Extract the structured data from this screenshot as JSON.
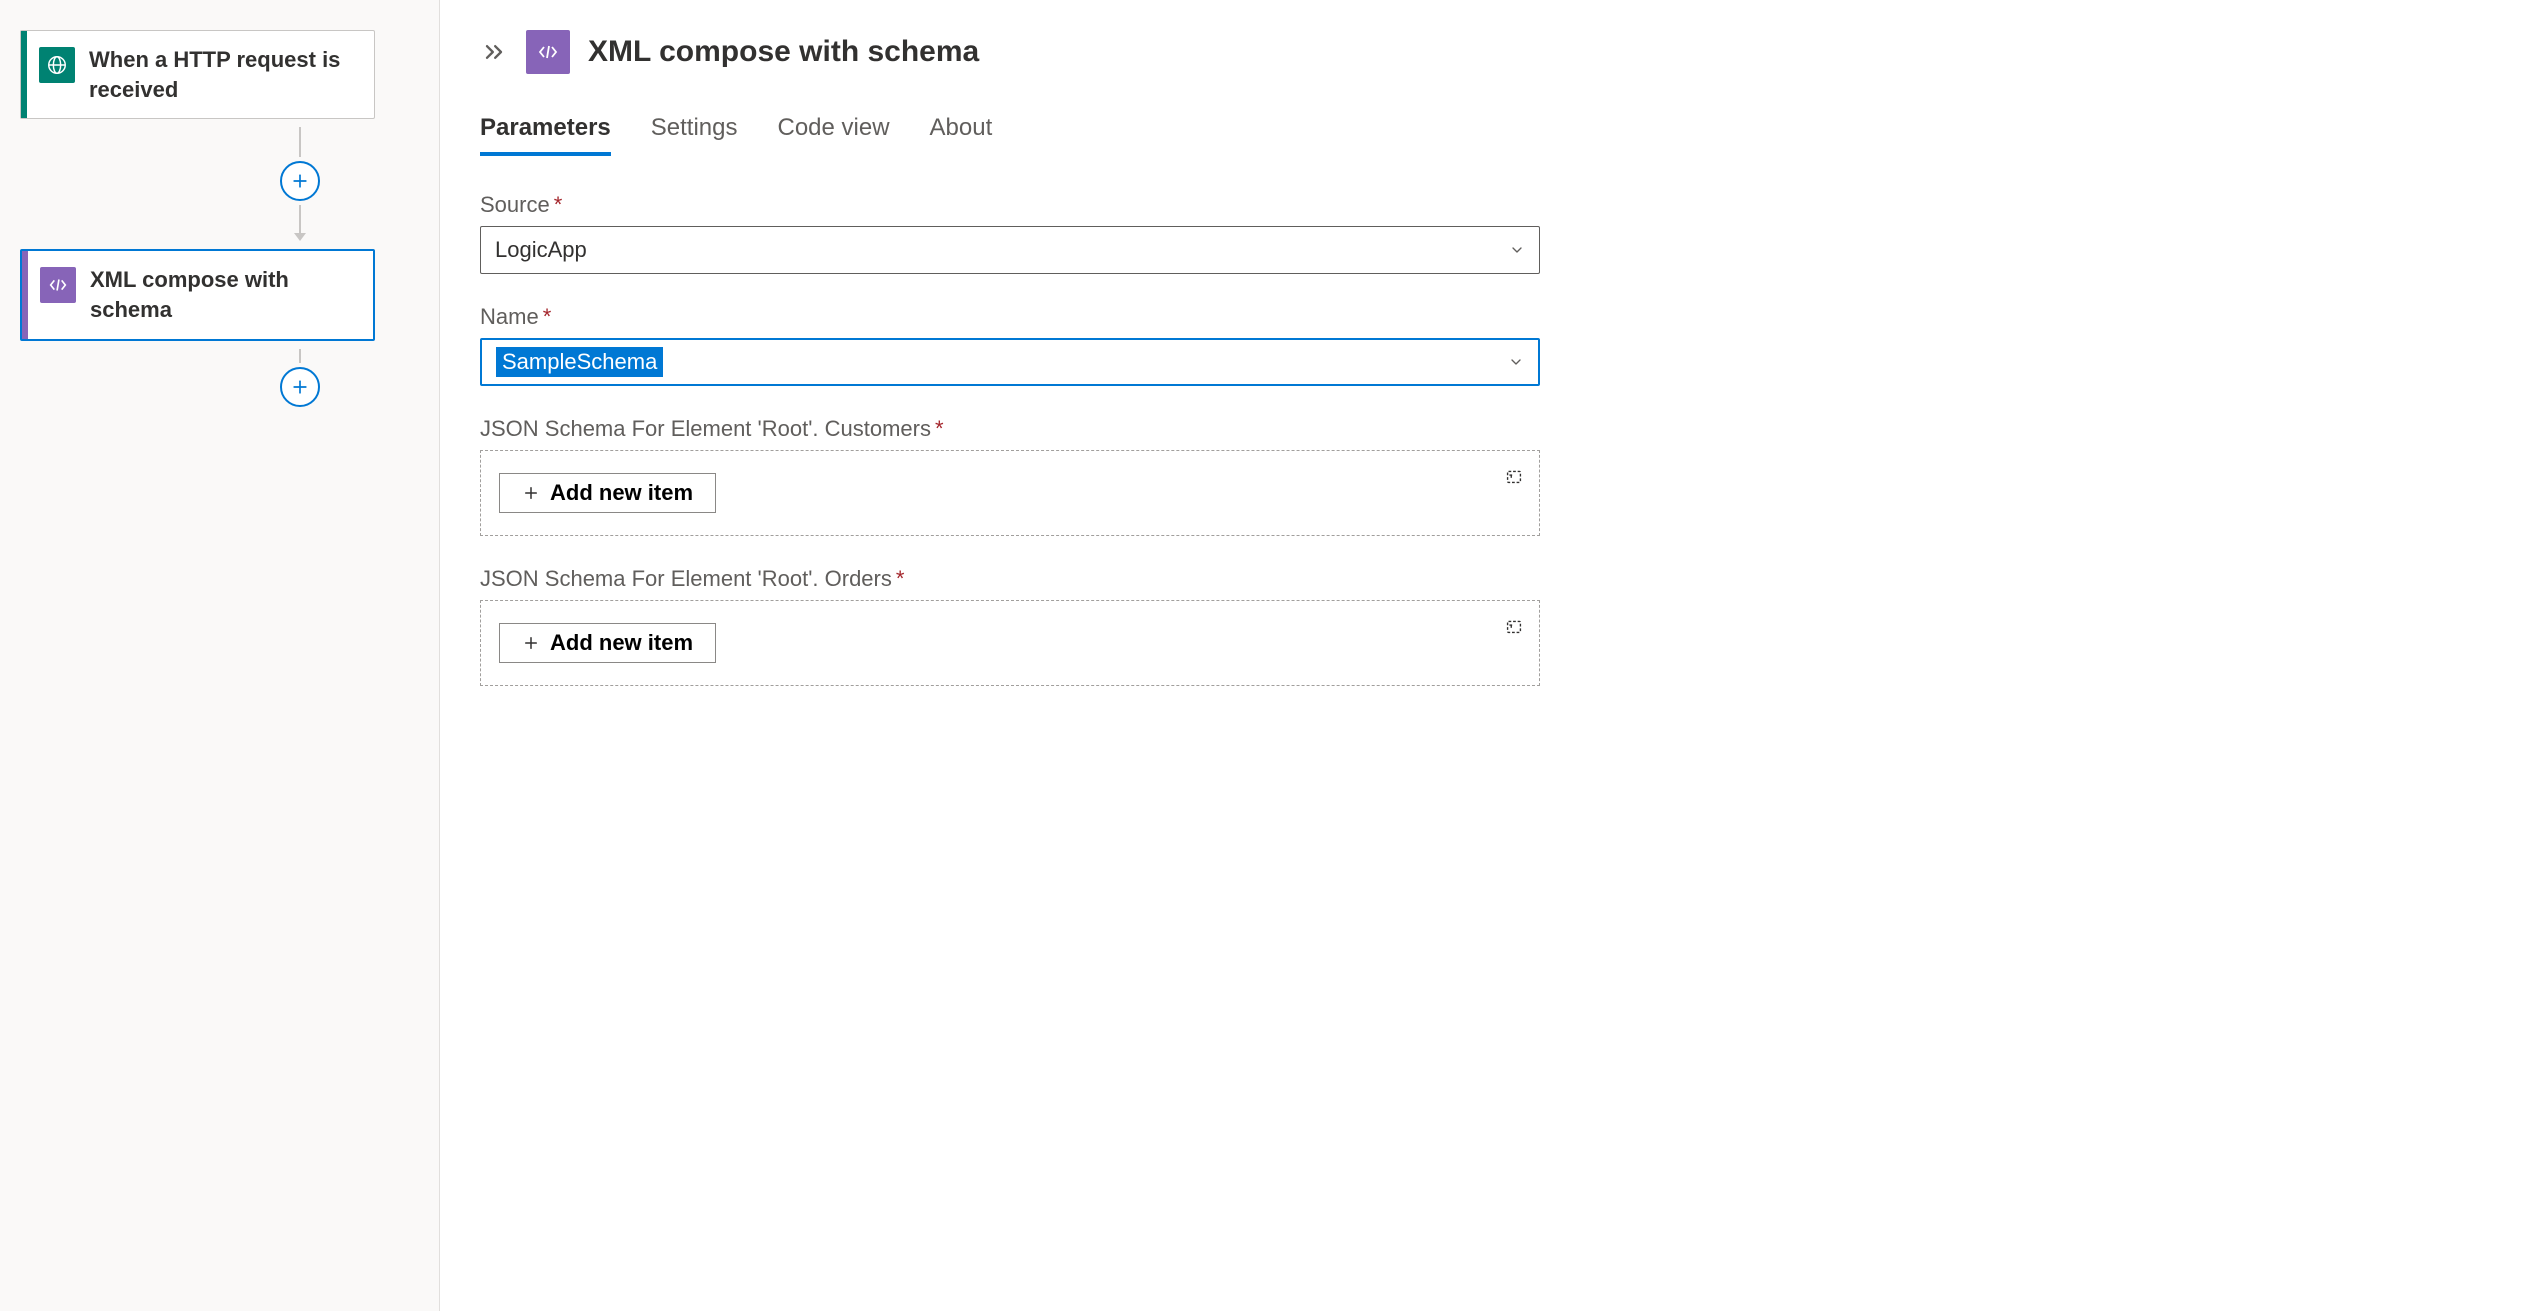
{
  "canvas": {
    "nodes": [
      {
        "label": "When a HTTP request is received",
        "icon": "http-trigger",
        "color": "teal",
        "selected": false
      },
      {
        "label": "XML compose with schema",
        "icon": "xml-action",
        "color": "purple",
        "selected": true
      }
    ]
  },
  "panel": {
    "title": "XML compose with schema",
    "icon": "xml-action",
    "tabs": [
      "Parameters",
      "Settings",
      "Code view",
      "About"
    ],
    "active_tab": "Parameters",
    "fields": {
      "source": {
        "label": "Source",
        "required": true,
        "value": "LogicApp"
      },
      "name": {
        "label": "Name",
        "required": true,
        "value": "SampleSchema",
        "focused": true,
        "selected_text": true
      },
      "json_schema_customers": {
        "label": "JSON Schema For Element 'Root'. Customers",
        "required": true,
        "add_label": "Add new item"
      },
      "json_schema_orders": {
        "label": "JSON Schema For Element 'Root'. Orders",
        "required": true,
        "add_label": "Add new item"
      }
    }
  }
}
